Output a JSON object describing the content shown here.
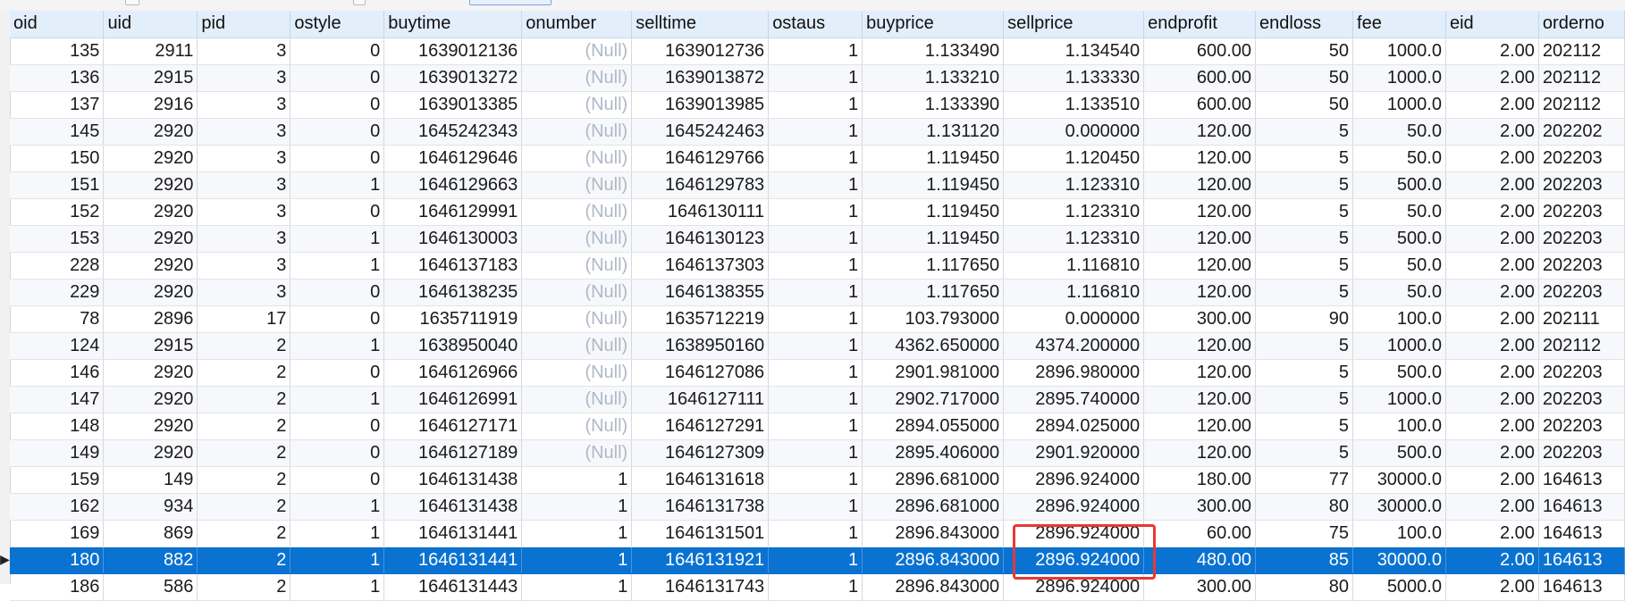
{
  "grid": {
    "columns": [
      "oid",
      "uid",
      "pid",
      "ostyle",
      "buytime",
      "onumber",
      "selltime",
      "ostaus",
      "buyprice",
      "sellprice",
      "endprofit",
      "endloss",
      "fee",
      "eid",
      "orderno"
    ],
    "rows": [
      [
        "135",
        "2911",
        "3",
        "0",
        "1639012136",
        "(Null)",
        "1639012736",
        "1",
        "1.133490",
        "1.134540",
        "600.00",
        "50",
        "1000.0",
        "2.00",
        "202112"
      ],
      [
        "136",
        "2915",
        "3",
        "0",
        "1639013272",
        "(Null)",
        "1639013872",
        "1",
        "1.133210",
        "1.133330",
        "600.00",
        "50",
        "1000.0",
        "2.00",
        "202112"
      ],
      [
        "137",
        "2916",
        "3",
        "0",
        "1639013385",
        "(Null)",
        "1639013985",
        "1",
        "1.133390",
        "1.133510",
        "600.00",
        "50",
        "1000.0",
        "2.00",
        "202112"
      ],
      [
        "145",
        "2920",
        "3",
        "0",
        "1645242343",
        "(Null)",
        "1645242463",
        "1",
        "1.131120",
        "0.000000",
        "120.00",
        "5",
        "50.0",
        "2.00",
        "202202"
      ],
      [
        "150",
        "2920",
        "3",
        "0",
        "1646129646",
        "(Null)",
        "1646129766",
        "1",
        "1.119450",
        "1.120450",
        "120.00",
        "5",
        "50.0",
        "2.00",
        "202203"
      ],
      [
        "151",
        "2920",
        "3",
        "1",
        "1646129663",
        "(Null)",
        "1646129783",
        "1",
        "1.119450",
        "1.123310",
        "120.00",
        "5",
        "500.0",
        "2.00",
        "202203"
      ],
      [
        "152",
        "2920",
        "3",
        "0",
        "1646129991",
        "(Null)",
        "1646130111",
        "1",
        "1.119450",
        "1.123310",
        "120.00",
        "5",
        "50.0",
        "2.00",
        "202203"
      ],
      [
        "153",
        "2920",
        "3",
        "1",
        "1646130003",
        "(Null)",
        "1646130123",
        "1",
        "1.119450",
        "1.123310",
        "120.00",
        "5",
        "500.0",
        "2.00",
        "202203"
      ],
      [
        "228",
        "2920",
        "3",
        "1",
        "1646137183",
        "(Null)",
        "1646137303",
        "1",
        "1.117650",
        "1.116810",
        "120.00",
        "5",
        "50.0",
        "2.00",
        "202203"
      ],
      [
        "229",
        "2920",
        "3",
        "0",
        "1646138235",
        "(Null)",
        "1646138355",
        "1",
        "1.117650",
        "1.116810",
        "120.00",
        "5",
        "50.0",
        "2.00",
        "202203"
      ],
      [
        "78",
        "2896",
        "17",
        "0",
        "1635711919",
        "(Null)",
        "1635712219",
        "1",
        "103.793000",
        "0.000000",
        "300.00",
        "90",
        "100.0",
        "2.00",
        "202111"
      ],
      [
        "124",
        "2915",
        "2",
        "1",
        "1638950040",
        "(Null)",
        "1638950160",
        "1",
        "4362.650000",
        "4374.200000",
        "120.00",
        "5",
        "1000.0",
        "2.00",
        "202112"
      ],
      [
        "146",
        "2920",
        "2",
        "0",
        "1646126966",
        "(Null)",
        "1646127086",
        "1",
        "2901.981000",
        "2896.980000",
        "120.00",
        "5",
        "500.0",
        "2.00",
        "202203"
      ],
      [
        "147",
        "2920",
        "2",
        "1",
        "1646126991",
        "(Null)",
        "1646127111",
        "1",
        "2902.717000",
        "2895.740000",
        "120.00",
        "5",
        "1000.0",
        "2.00",
        "202203"
      ],
      [
        "148",
        "2920",
        "2",
        "0",
        "1646127171",
        "(Null)",
        "1646127291",
        "1",
        "2894.055000",
        "2894.025000",
        "120.00",
        "5",
        "100.0",
        "2.00",
        "202203"
      ],
      [
        "149",
        "2920",
        "2",
        "0",
        "1646127189",
        "(Null)",
        "1646127309",
        "1",
        "2895.406000",
        "2901.920000",
        "120.00",
        "5",
        "500.0",
        "2.00",
        "202203"
      ],
      [
        "159",
        "149",
        "2",
        "0",
        "1646131438",
        "1",
        "1646131618",
        "1",
        "2896.681000",
        "2896.924000",
        "180.00",
        "77",
        "30000.0",
        "2.00",
        "164613"
      ],
      [
        "162",
        "934",
        "2",
        "1",
        "1646131438",
        "1",
        "1646131738",
        "1",
        "2896.681000",
        "2896.924000",
        "300.00",
        "80",
        "30000.0",
        "2.00",
        "164613"
      ],
      [
        "169",
        "869",
        "2",
        "1",
        "1646131441",
        "1",
        "1646131501",
        "1",
        "2896.843000",
        "2896.924000",
        "60.00",
        "75",
        "100.0",
        "2.00",
        "164613"
      ],
      [
        "180",
        "882",
        "2",
        "1",
        "1646131441",
        "1",
        "1646131921",
        "1",
        "2896.843000",
        "2896.924000",
        "480.00",
        "85",
        "30000.0",
        "2.00",
        "164613"
      ],
      [
        "186",
        "586",
        "2",
        "1",
        "1646131443",
        "1",
        "1646131743",
        "1",
        "2896.843000",
        "2896.924000",
        "300.00",
        "80",
        "5000.0",
        "2.00",
        "164613"
      ]
    ],
    "selected_row": 19
  },
  "gutter": {
    "current_row_marker": "▶"
  }
}
